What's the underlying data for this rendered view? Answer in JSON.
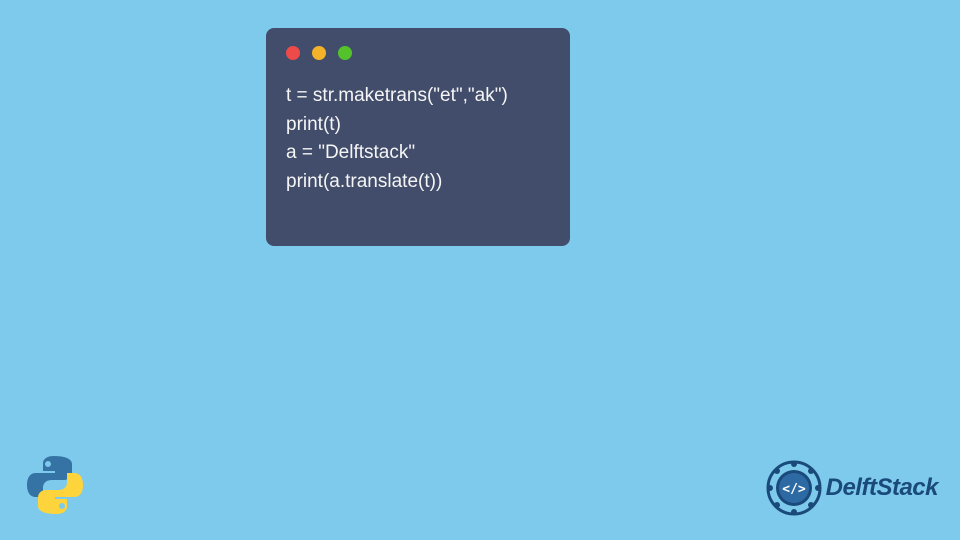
{
  "code": {
    "line1": "t = str.maketrans(\"et\",\"ak\")",
    "line2": "print(t)",
    "line3": "a = \"Delftstack\"",
    "line4": "print(a.translate(t))"
  },
  "logos": {
    "python_name": "python-icon",
    "brand_name": "DelftStack"
  },
  "colors": {
    "background": "#7ecaed",
    "window_bg": "#424d6b",
    "code_text": "#f5f5f5",
    "brand_blue": "#1a4a7a"
  }
}
